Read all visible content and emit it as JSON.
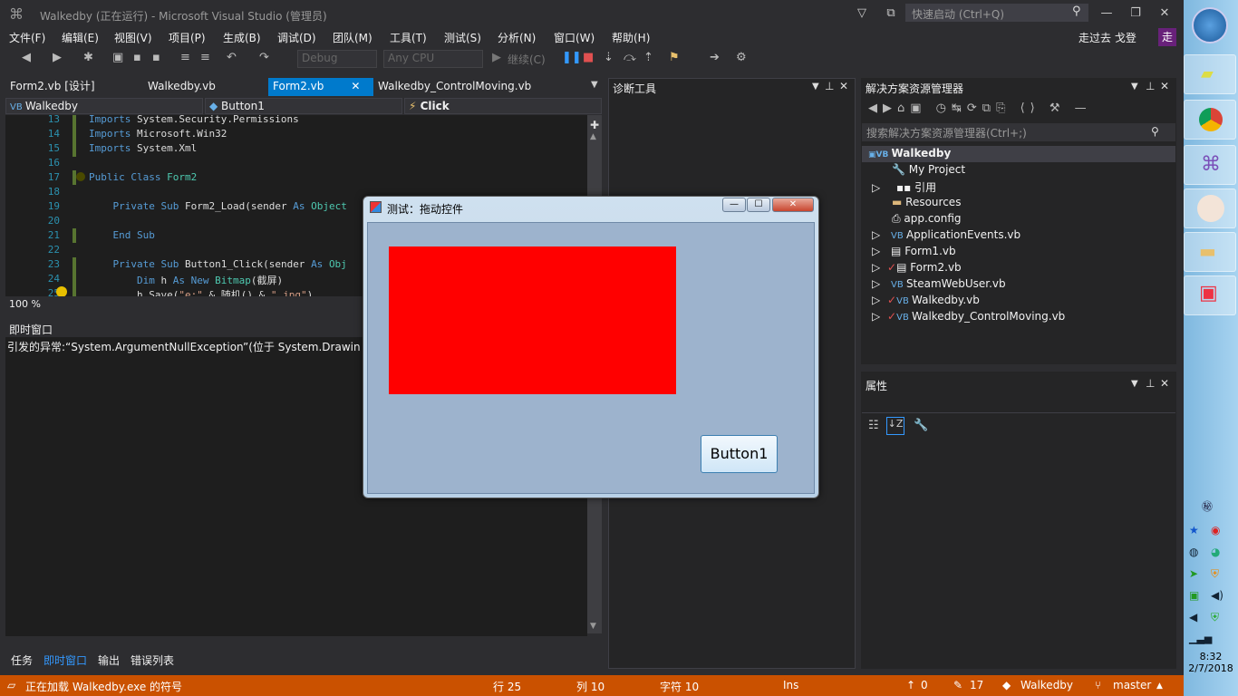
{
  "window": {
    "title": "Walkedby (正在运行) - Microsoft Visual Studio (管理员)",
    "quick_launch_placeholder": "快速启动 (Ctrl+Q)"
  },
  "menu": [
    "文件(F)",
    "编辑(E)",
    "视图(V)",
    "项目(P)",
    "生成(B)",
    "调试(D)",
    "团队(M)",
    "工具(T)",
    "测试(S)",
    "分析(N)",
    "窗口(W)",
    "帮助(H)"
  ],
  "user": {
    "name": "走过去 戈登",
    "avatar": "走"
  },
  "toolbar": {
    "config": "Debug",
    "platform": "Any CPU",
    "continue": "继续(C)"
  },
  "tabs": [
    "Form2.vb [设计]",
    "Walkedby.vb",
    "Form2.vb",
    "Walkedby_ControlMoving.vb"
  ],
  "nav": {
    "project": "Walkedby",
    "object": "Button1",
    "event": "Click"
  },
  "code": {
    "lines": [
      "13",
      "14",
      "15",
      "16",
      "17",
      "18",
      "19",
      "20",
      "21",
      "22",
      "23",
      "24",
      "25"
    ]
  },
  "editor_zoom": "100 %",
  "immediate": {
    "title": "即时窗口",
    "text": "引发的异常:“System.ArgumentNullException”(位于 System.Drawing.d"
  },
  "bottom_tabs": [
    "任务",
    "即时窗口",
    "输出",
    "错误列表"
  ],
  "diagnostics": {
    "title": "诊断工具"
  },
  "solution": {
    "title": "解决方案资源管理器",
    "search_placeholder": "搜索解决方案资源管理器(Ctrl+;)",
    "items": [
      "Walkedby",
      "My Project",
      "引用",
      "Resources",
      "app.config",
      "ApplicationEvents.vb",
      "Form1.vb",
      "Form2.vb",
      "SteamWebUser.vb",
      "Walkedby.vb",
      "Walkedby_ControlMoving.vb"
    ]
  },
  "properties": {
    "title": "属性"
  },
  "status": {
    "loading": "正在加载 Walkedby.exe 的符号",
    "line": "行 25",
    "col": "列 10",
    "char": "字符 10",
    "mode": "Ins",
    "up": "0",
    "edits": "17",
    "repo": "Walkedby",
    "branch": "master"
  },
  "dialog": {
    "title": "测试：拖动控件",
    "button": "Button1"
  },
  "clock": {
    "time": "8:32",
    "date": "2/7/2018"
  }
}
